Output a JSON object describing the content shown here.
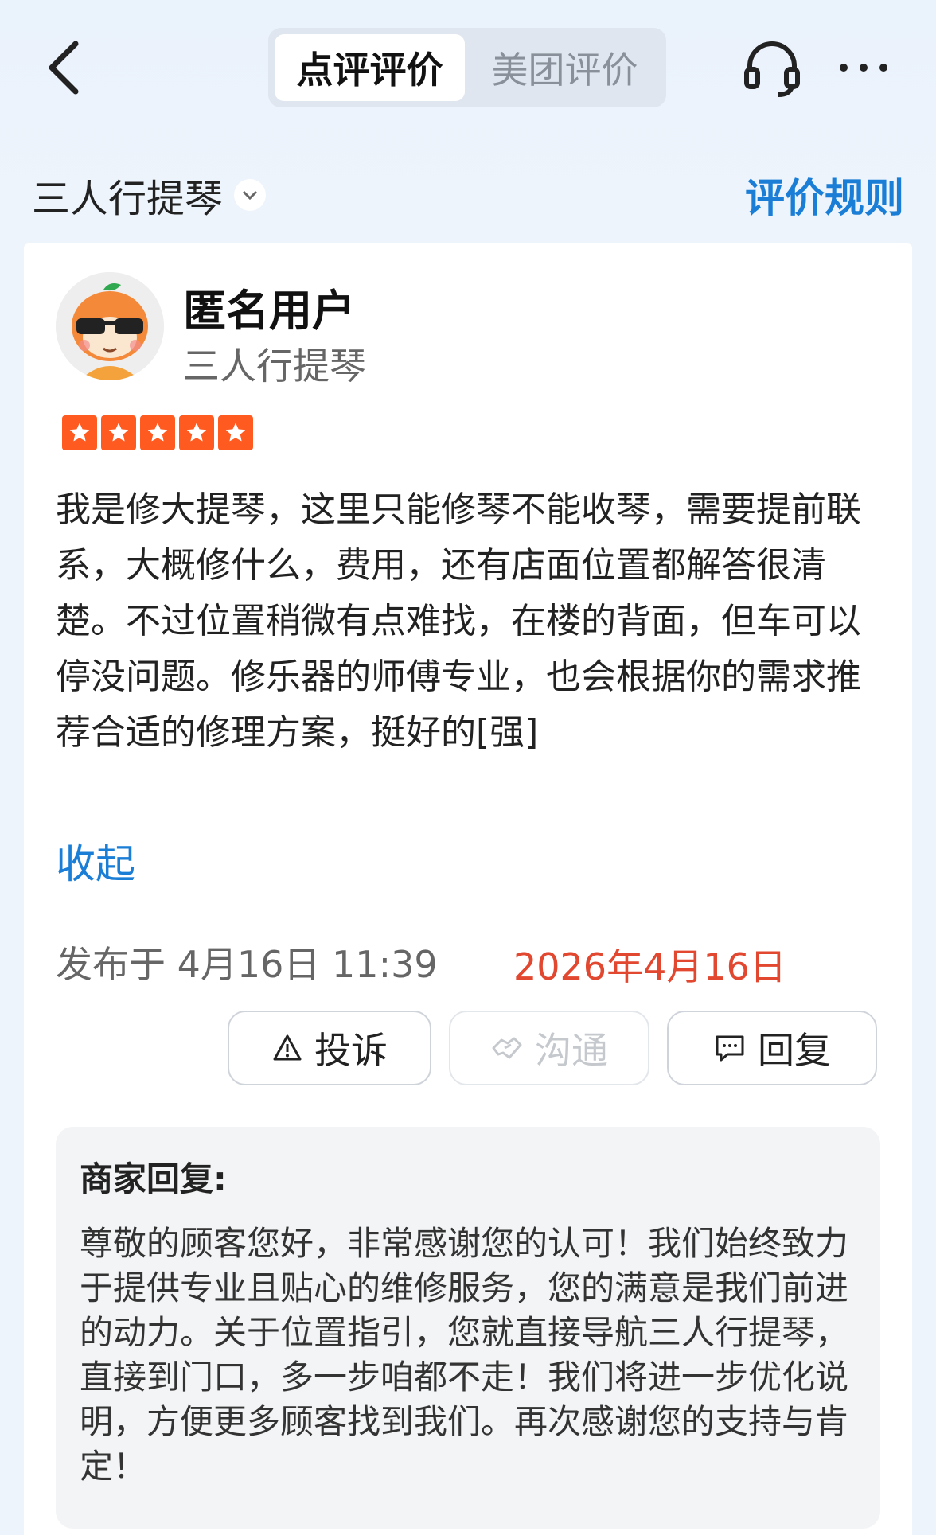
{
  "header": {
    "tabs": [
      {
        "label": "点评评价",
        "active": true
      },
      {
        "label": "美团评价",
        "active": false
      }
    ]
  },
  "shop": {
    "name": "三人行提琴",
    "rules_link": "评价规则"
  },
  "review": {
    "user_name": "匿名用户",
    "shop_label": "三人行提琴",
    "rating": 5,
    "text": "我是修大提琴，这里只能修琴不能收琴，需要提前联系，大概修什么，费用，还有店面位置都解答很清楚。不过位置稍微有点难找，在楼的背面，但车可以停没问题。修乐器的师傅专业，也会根据你的需求推荐合适的修理方案，挺好的[强]",
    "collapse_label": "收起",
    "published": "发布于 4月16日 11:39",
    "date_stamp": "2026年4月16日"
  },
  "actions": {
    "complain": "投诉",
    "communicate": "沟通",
    "reply": "回复"
  },
  "merchant_reply": {
    "title": "商家回复:",
    "body": "尊敬的顾客您好，非常感谢您的认可！我们始终致力于提供专业且贴心的维修服务，您的满意是我们前进的动力。关于位置指引，您就直接导航三人行提琴，直接到门口，多一步咱都不走！我们将进一步优化说明，方便更多顾客找到我们。再次感谢您的支持与肯定！"
  },
  "colors": {
    "accent": "#1b7ed6",
    "star": "#ff5a1f",
    "date_stamp": "#e2472f"
  }
}
